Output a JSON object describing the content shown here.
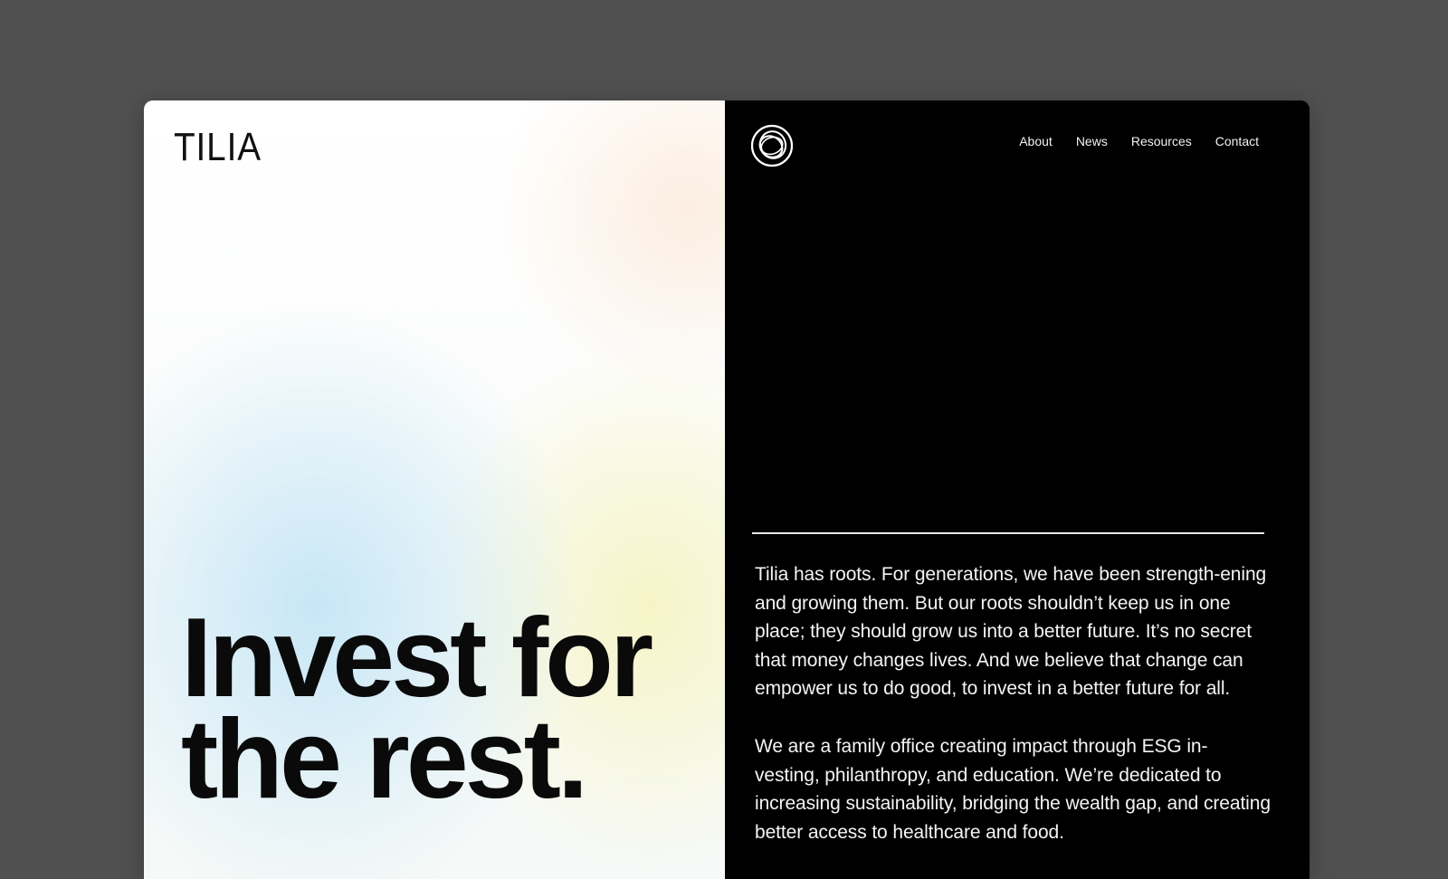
{
  "brand": {
    "wordmark": "TILIA",
    "mark_icon": "circular-rings-logo-icon"
  },
  "nav": {
    "items": [
      {
        "label": "About"
      },
      {
        "label": "News"
      },
      {
        "label": "Resources"
      },
      {
        "label": "Contact"
      }
    ]
  },
  "hero": {
    "headline_line1": "Invest for",
    "headline_line2": "the rest."
  },
  "intro": {
    "paragraph1": "Tilia has roots. For generations, we have been strength-ening and growing them. But our roots shouldn’t keep us in one place; they should grow us into a better future. It’s no secret that money changes lives. And we believe that change can empower us to do good, to invest in a better future for all.",
    "paragraph2": "We are a family office creating impact through ESG in-vesting, philanthropy, and education. We’re dedicated to increasing sustainability, bridging the wealth gap, and creating better access to healthcare and food."
  },
  "colors": {
    "page_bg": "#505050",
    "dark_panel": "#000000",
    "text_dark": "#0a0a0a",
    "text_light": "#f4f4f4"
  }
}
